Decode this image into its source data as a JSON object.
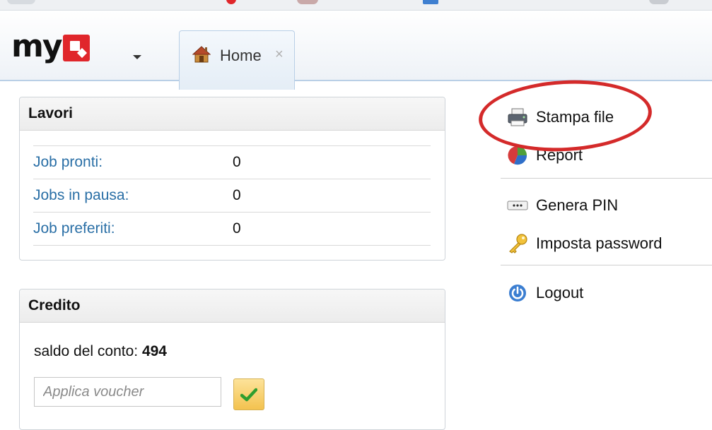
{
  "app": {
    "logo_text": "myQ",
    "logo_colors": {
      "text": "#111111",
      "q_block": "#e0262b"
    }
  },
  "tabs": [
    {
      "label": "Home",
      "icon": "house-icon",
      "close": "×"
    }
  ],
  "lavori": {
    "title": "Lavori",
    "rows": [
      {
        "label": "Job pronti:",
        "value": "0"
      },
      {
        "label": "Jobs in pausa:",
        "value": "0"
      },
      {
        "label": "Job preferiti:",
        "value": "0"
      }
    ]
  },
  "credito": {
    "title": "Credito",
    "balance_label": "saldo del conto:",
    "balance_value": "494",
    "voucher_placeholder": "Applica voucher",
    "voucher_value": "",
    "apply_icon": "checkmark-icon"
  },
  "menu": {
    "items": [
      {
        "label": "Stampa file",
        "icon": "printer-icon"
      },
      {
        "label": "Report",
        "icon": "pie-chart-icon"
      },
      {
        "label": "Genera PIN",
        "icon": "pin-card-icon"
      },
      {
        "label": "Imposta password",
        "icon": "key-icon"
      },
      {
        "label": "Logout",
        "icon": "power-icon"
      }
    ]
  },
  "colors": {
    "link": "#2a6fa6",
    "highlight_circle": "#d42a2a",
    "apply_button": "#f3c24f"
  }
}
